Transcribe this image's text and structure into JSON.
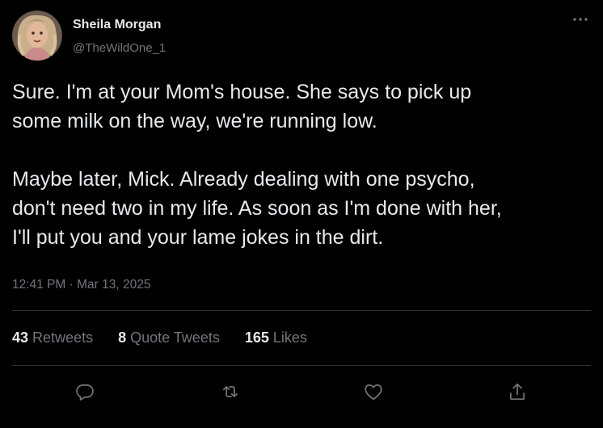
{
  "author": {
    "display_name": "Sheila Morgan",
    "handle": "@TheWildOne_1",
    "avatar_icon": "profile-photo"
  },
  "tweet": {
    "text": "Sure. I'm at your Mom's house. She says to pick up\nsome milk on the way, we're running low.\n\nMaybe later, Mick. Already dealing with one psycho,\ndon't need two in my life. As soon as I'm done with her,\nI'll put you and your lame jokes in the dirt.",
    "timestamp": "12:41 PM · Mar 13, 2025"
  },
  "stats": {
    "retweets_count": "43",
    "retweets_label": "Retweets",
    "quotes_count": "8",
    "quotes_label": "Quote Tweets",
    "likes_count": "165",
    "likes_label": "Likes"
  },
  "actions": [
    {
      "icon": "reply-icon"
    },
    {
      "icon": "retweet-icon"
    },
    {
      "icon": "like-icon"
    },
    {
      "icon": "share-icon"
    }
  ],
  "theme": {
    "background": "#000000",
    "text_primary": "#e7e9ea",
    "text_secondary": "#71767b",
    "divider": "#2f3336"
  }
}
